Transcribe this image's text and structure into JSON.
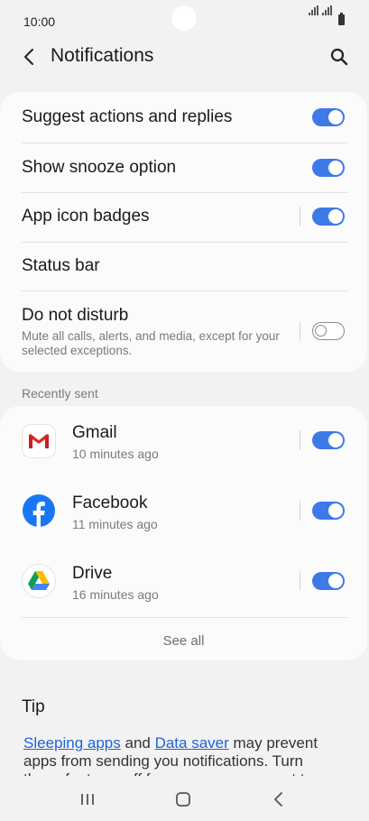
{
  "status_bar": {
    "time": "10:00"
  },
  "header": {
    "title": "Notifications"
  },
  "settings": {
    "suggest": {
      "label": "Suggest actions and replies",
      "enabled": true
    },
    "snooze": {
      "label": "Show snooze option",
      "enabled": true
    },
    "badges": {
      "label": "App icon badges",
      "enabled": true
    },
    "status_bar": {
      "label": "Status bar"
    },
    "dnd": {
      "label": "Do not disturb",
      "description": "Mute all calls, alerts, and media, except for your selected exceptions.",
      "enabled": false
    }
  },
  "recently_sent": {
    "heading": "Recently sent",
    "apps": [
      {
        "name": "Gmail",
        "time": "10 minutes ago",
        "icon": "gmail-icon",
        "enabled": true
      },
      {
        "name": "Facebook",
        "time": "11 minutes ago",
        "icon": "facebook-icon",
        "enabled": true
      },
      {
        "name": "Drive",
        "time": "16 minutes ago",
        "icon": "drive-icon",
        "enabled": true
      }
    ],
    "see_all": "See all"
  },
  "tip": {
    "title": "Tip",
    "link1": "Sleeping apps",
    "and": " and ",
    "link2": "Data saver",
    "rest": " may prevent apps from sending you notifications. Turn these features off for any apps you want to"
  },
  "colors": {
    "accent": "#3e79e8",
    "background": "#f2f2f2",
    "card": "#fbfbfb"
  }
}
